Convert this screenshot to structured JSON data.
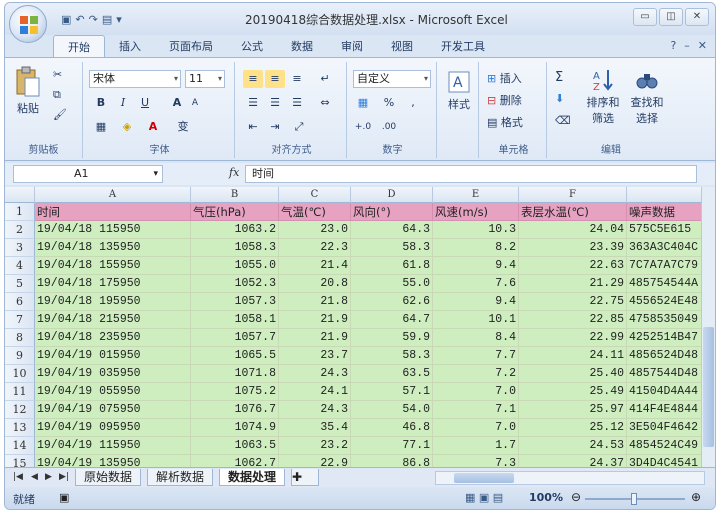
{
  "window": {
    "title": "20190418综合数据处理.xlsx - Microsoft Excel",
    "controls": [
      "▭",
      "◫",
      "✕"
    ]
  },
  "ribbon_tabs": [
    "开始",
    "插入",
    "页面布局",
    "公式",
    "数据",
    "审阅",
    "视图",
    "开发工具"
  ],
  "ribbon_tabs_active": 0,
  "ribbon_right": [
    "?",
    "–",
    "✕"
  ],
  "ribbon": {
    "clipboard": {
      "paste": "粘贴",
      "group": "剪贴板"
    },
    "font": {
      "name": "宋体",
      "size": "11",
      "bold": "B",
      "italic": "I",
      "underline": "U",
      "grow": "A",
      "shrink": "A",
      "wen": "变",
      "group": "字体"
    },
    "alignment": {
      "group": "对齐方式"
    },
    "number": {
      "format": "自定义",
      "percent": "%",
      "comma": ",",
      "group": "数字"
    },
    "styles": {
      "label": "样式"
    },
    "cells": {
      "insert": "插入",
      "delete": "删除",
      "format": "格式",
      "group": "单元格"
    },
    "editing": {
      "sigma": "Σ",
      "sort": "排序和",
      "filter": "筛选",
      "find": "查找和",
      "select": "选择",
      "group": "编辑"
    }
  },
  "formula_bar": {
    "name_box": "A1",
    "fx": "fx",
    "content": "时间"
  },
  "columns": [
    "A",
    "B",
    "C",
    "D",
    "E",
    "F"
  ],
  "header_row": [
    "时间",
    "气压(hPa)",
    "气温(℃)",
    "风向(°)",
    "风速(m/s)",
    "表层水温(℃)",
    "噪声数据"
  ],
  "rows": [
    [
      "19/04/18 115950",
      "1063.2",
      "23.0",
      "64.3",
      "10.3",
      "24.04",
      "575C5E615"
    ],
    [
      "19/04/18 135950",
      "1058.3",
      "22.3",
      "58.3",
      "8.2",
      "23.39",
      "363A3C404C"
    ],
    [
      "19/04/18 155950",
      "1055.0",
      "21.4",
      "61.8",
      "9.4",
      "22.63",
      "7C7A7A7C79"
    ],
    [
      "19/04/18 175950",
      "1052.3",
      "20.8",
      "55.0",
      "7.6",
      "21.29",
      "485754544A"
    ],
    [
      "19/04/18 195950",
      "1057.3",
      "21.8",
      "62.6",
      "9.4",
      "22.75",
      "4556524E48"
    ],
    [
      "19/04/18 215950",
      "1058.1",
      "21.9",
      "64.7",
      "10.1",
      "22.85",
      "4758535049"
    ],
    [
      "19/04/18 235950",
      "1057.7",
      "21.9",
      "59.9",
      "8.4",
      "22.99",
      "4252514B47"
    ],
    [
      "19/04/19 015950",
      "1065.5",
      "23.7",
      "58.3",
      "7.7",
      "24.11",
      "4856524D48"
    ],
    [
      "19/04/19 035950",
      "1071.8",
      "24.3",
      "63.5",
      "7.2",
      "25.40",
      "4857544D48"
    ],
    [
      "19/04/19 055950",
      "1075.2",
      "24.1",
      "57.1",
      "7.0",
      "25.49",
      "41504D4A44"
    ],
    [
      "19/04/19 075950",
      "1076.7",
      "24.3",
      "54.0",
      "7.1",
      "25.97",
      "414F4E4844"
    ],
    [
      "19/04/19 095950",
      "1074.9",
      "35.4",
      "46.8",
      "7.0",
      "25.12",
      "3E504F4642"
    ],
    [
      "19/04/19 115950",
      "1063.5",
      "23.2",
      "77.1",
      "1.7",
      "24.53",
      "4854524C49"
    ],
    [
      "19/04/19 135950",
      "1062.7",
      "22.9",
      "86.8",
      "7.3",
      "24.37",
      "3D4D4C4541"
    ]
  ],
  "sheet_tabs": [
    "原始数据",
    "解析数据",
    "数据处理"
  ],
  "sheet_active": 2,
  "status": {
    "mode": "就绪",
    "zoom": "100%"
  },
  "colors": {
    "header_fill": "#e7a2c2",
    "data_fill": "#cfeec0",
    "ribbon": "#dbe6f4"
  }
}
